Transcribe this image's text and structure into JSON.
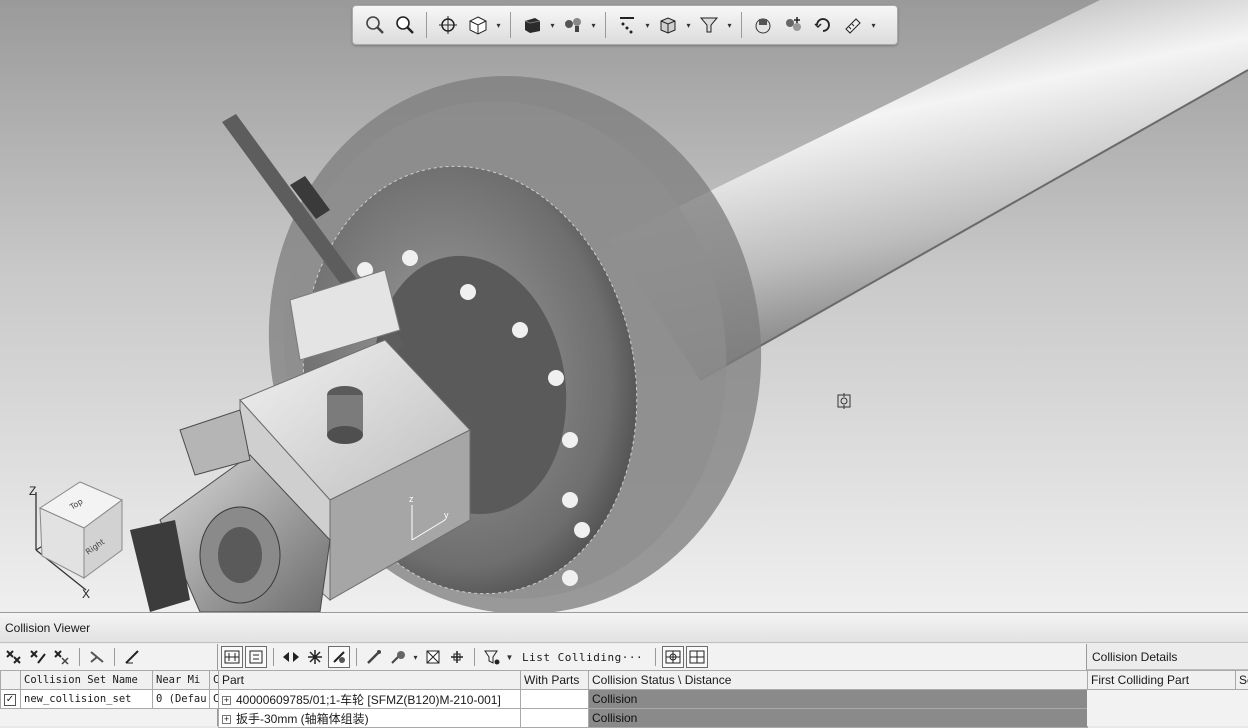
{
  "viewport": {
    "triad": {
      "x": "X",
      "y": "Y",
      "z": "Z"
    },
    "view_cube": {
      "top": "Top",
      "right": "Right"
    },
    "local_axes": {
      "z": "z",
      "y": "y"
    }
  },
  "view_toolbar": {
    "buttons": [
      {
        "name": "zoom-in-icon"
      },
      {
        "name": "zoom-fit-icon"
      },
      {
        "name": "orient-target-icon"
      },
      {
        "name": "view-cube-icon",
        "dropdown": true
      },
      {
        "name": "shaded-box-icon",
        "dropdown": true
      },
      {
        "name": "lighting-icon",
        "dropdown": true
      },
      {
        "name": "snap-points-icon",
        "dropdown": true
      },
      {
        "name": "display-part-icon",
        "dropdown": true
      },
      {
        "name": "selection-filter-icon",
        "dropdown": true
      },
      {
        "name": "show-hide-icon"
      },
      {
        "name": "add-component-icon"
      },
      {
        "name": "refresh-view-icon"
      },
      {
        "name": "measure-icon",
        "dropdown": true
      }
    ]
  },
  "collision_viewer": {
    "title": "Collision Viewer",
    "sets_table": {
      "columns": [
        "Collision Set Name",
        "Near Mi",
        "C"
      ],
      "rows": [
        {
          "checked": "✓",
          "name": "new_collision_set",
          "near_miss": "0 (Defau",
          "c": "C"
        }
      ]
    },
    "parts_toolbar": {
      "list_label": "List Colliding···"
    },
    "parts_table": {
      "columns": [
        "Part",
        "With Parts",
        "Collision Status \\ Distance"
      ],
      "rows": [
        {
          "expander": "+",
          "part": "40000609785/01;1-车轮 [SFMZ(B120)M-210-001]",
          "with_parts": "",
          "status": "Collision"
        },
        {
          "expander": "+",
          "part": "扳手-30mm (轴箱体组装)",
          "with_parts": "",
          "status": "Collision"
        }
      ]
    },
    "details": {
      "title": "Collision Details",
      "columns": [
        "First Colliding Part",
        "Se"
      ]
    }
  }
}
